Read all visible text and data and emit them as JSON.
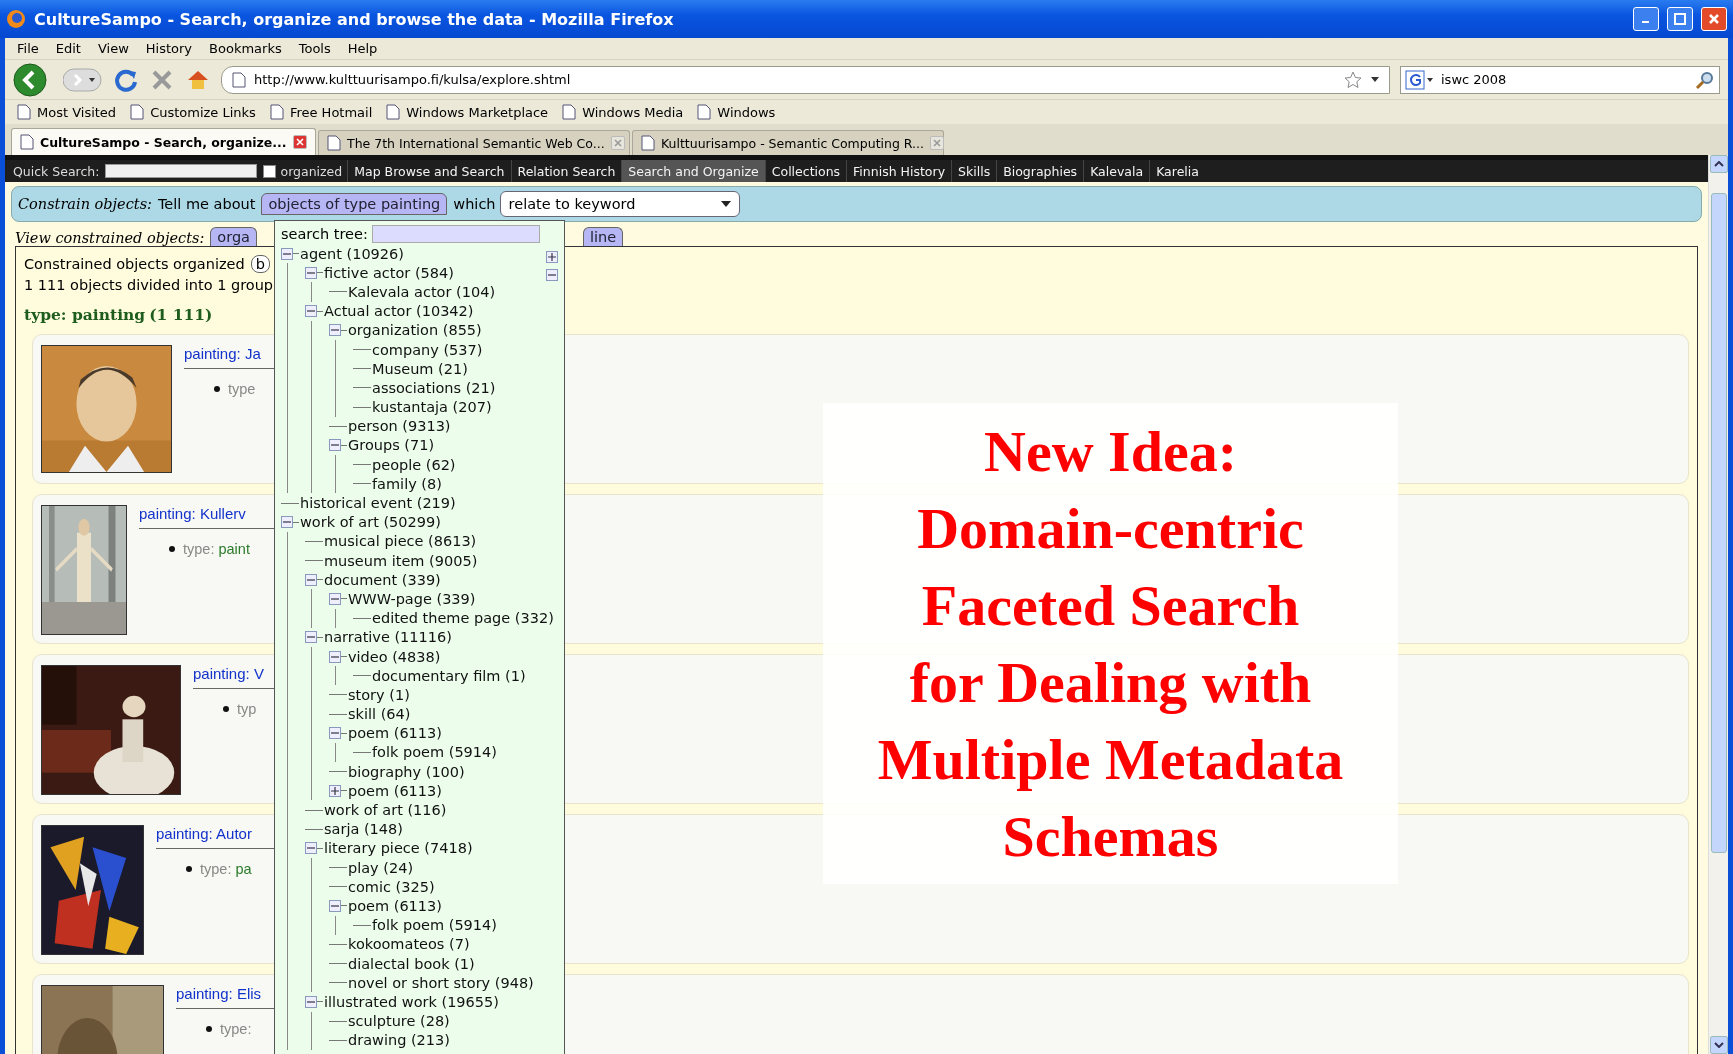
{
  "window": {
    "title": "CultureSampo - Search, organize and browse the data - Mozilla Firefox",
    "menu": [
      "File",
      "Edit",
      "View",
      "History",
      "Bookmarks",
      "Tools",
      "Help"
    ]
  },
  "toolbar": {
    "url": "http://www.kulttuurisampo.fi/kulsa/explore.shtml",
    "search": "iswc 2008"
  },
  "bookmarks": [
    "Most Visited",
    "Customize Links",
    "Free Hotmail",
    "Windows Marketplace",
    "Windows Media",
    "Windows"
  ],
  "tabs": [
    {
      "label": "CultureSampo - Search, organize...",
      "selected": true
    },
    {
      "label": "The 7th International Semantic Web Co...",
      "selected": false
    },
    {
      "label": "Kulttuurisampo - Semantic Computing R...",
      "selected": false
    }
  ],
  "site_nav": {
    "quick_search_label": "Quick Search:",
    "organized": {
      "label": "organized",
      "checked": false
    },
    "items": [
      {
        "label": "Map Browse and Search",
        "selected": false
      },
      {
        "label": "Relation Search",
        "selected": false
      },
      {
        "label": "Search and Organize",
        "selected": true
      },
      {
        "label": "Collections",
        "selected": false
      },
      {
        "label": "Finnish History",
        "selected": false
      },
      {
        "label": "Skills",
        "selected": false
      },
      {
        "label": "Biographies",
        "selected": false
      },
      {
        "label": "Kalevala",
        "selected": false
      },
      {
        "label": "Karelia",
        "selected": false
      }
    ]
  },
  "constrain": {
    "label": "Constrain objects:",
    "prefix": "Tell me about",
    "type_button": "objects of type painting",
    "which": "which",
    "relation": "relate to keyword"
  },
  "view": {
    "label": "View constrained objects:",
    "tabs": [
      "orga",
      "line"
    ]
  },
  "results": {
    "organized_label": "Constrained objects organized",
    "organized_button": "b",
    "summary": "1 111 objects divided into 1 group",
    "group_heading": "type: painting",
    "group_count": "(1 111)",
    "items": [
      {
        "title": "painting: Ja",
        "type_label": "type"
      },
      {
        "title": "painting: Kullerv",
        "type_label": "type:",
        "type_value": "paint"
      },
      {
        "title": "painting: V",
        "type_label": "typ"
      },
      {
        "title": "painting: Autor",
        "type_label": "type:",
        "type_value": "pa"
      },
      {
        "title": "painting: Elis",
        "type_label": "type:"
      }
    ]
  },
  "tree_popup": {
    "search_label": "search tree:",
    "tree": [
      {
        "label": "agent (10926)",
        "expanded": true,
        "children": [
          {
            "label": "fictive actor (584)",
            "expanded": true,
            "children": [
              {
                "label": "Kalevala actor (104)"
              }
            ]
          },
          {
            "label": "Actual actor (10342)",
            "expanded": true,
            "children": [
              {
                "label": "organization (855)",
                "expanded": true,
                "children": [
                  {
                    "label": "company (537)"
                  },
                  {
                    "label": "Museum (21)"
                  },
                  {
                    "label": "associations (21)"
                  },
                  {
                    "label": "kustantaja (207)"
                  }
                ]
              },
              {
                "label": "person (9313)"
              },
              {
                "label": "Groups (71)",
                "expanded": true,
                "children": [
                  {
                    "label": "people (62)"
                  },
                  {
                    "label": "family (8)"
                  }
                ]
              }
            ]
          }
        ]
      },
      {
        "label": "historical event (219)"
      },
      {
        "label": "work of art (50299)",
        "expanded": true,
        "children": [
          {
            "label": "musical piece (8613)"
          },
          {
            "label": "museum item (9005)"
          },
          {
            "label": "document (339)",
            "expanded": true,
            "children": [
              {
                "label": "WWW-page (339)",
                "expanded": true,
                "children": [
                  {
                    "label": "edited theme page (332)"
                  }
                ]
              }
            ]
          },
          {
            "label": "narrative (11116)",
            "expanded": true,
            "children": [
              {
                "label": "video (4838)",
                "expanded": true,
                "children": [
                  {
                    "label": "documentary film (1)"
                  }
                ]
              },
              {
                "label": "story (1)"
              },
              {
                "label": "skill (64)"
              },
              {
                "label": "poem (6113)",
                "expanded": true,
                "children": [
                  {
                    "label": "folk poem (5914)"
                  }
                ]
              },
              {
                "label": "biography (100)"
              },
              {
                "label": "poem (6113)",
                "expanded": false
              }
            ]
          },
          {
            "label": "work of art (116)"
          },
          {
            "label": "sarja (148)"
          },
          {
            "label": "literary piece (7418)",
            "expanded": true,
            "children": [
              {
                "label": "play (24)"
              },
              {
                "label": "comic (325)"
              },
              {
                "label": "poem (6113)",
                "expanded": true,
                "children": [
                  {
                    "label": "folk poem (5914)"
                  }
                ]
              },
              {
                "label": "kokoomateos (7)"
              },
              {
                "label": "dialectal book (1)"
              },
              {
                "label": "novel or short story (948)"
              }
            ]
          },
          {
            "label": "illustrated work (19655)",
            "expanded": true,
            "children": [
              {
                "label": "sculpture (28)"
              },
              {
                "label": "drawing (213)"
              }
            ]
          }
        ]
      }
    ]
  },
  "overlay": {
    "lines": [
      "New Idea:",
      "Domain-centric",
      "Faceted Search",
      "for Dealing with",
      "Multiple Metadata",
      "Schemas"
    ]
  }
}
